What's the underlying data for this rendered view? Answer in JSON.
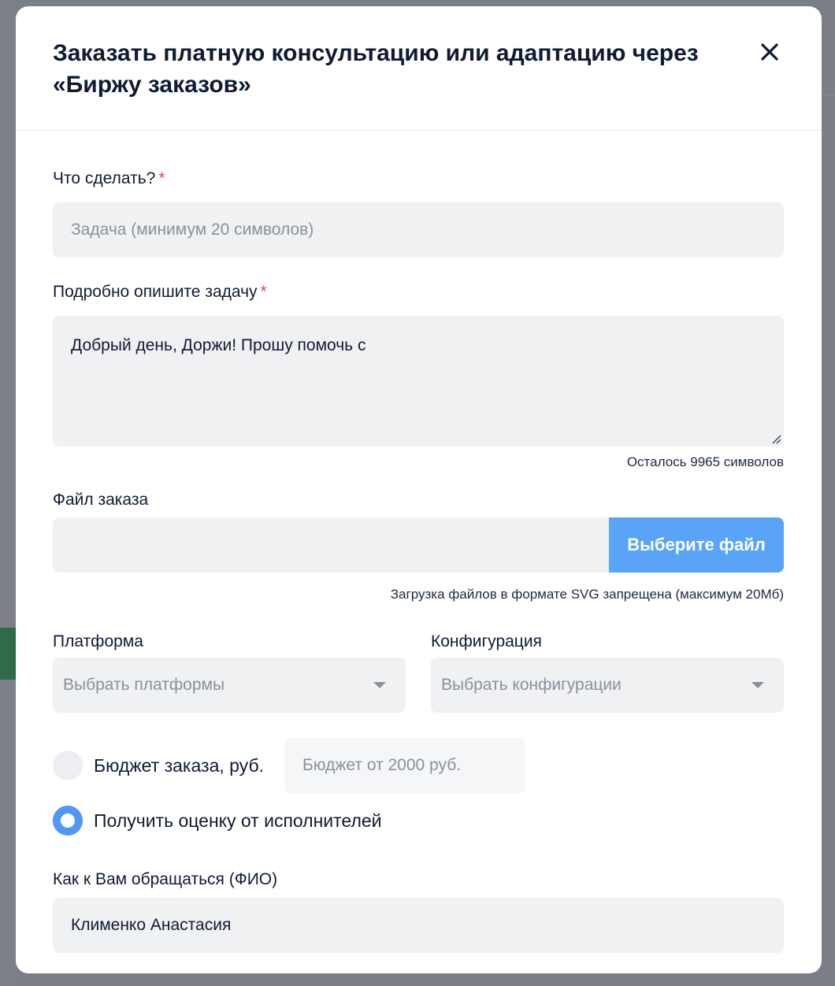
{
  "modal": {
    "title": "Заказать платную консультацию или адаптацию через «Биржу заказов»",
    "close_icon": "close-icon"
  },
  "task": {
    "label": "Что сделать?",
    "required_mark": "*",
    "placeholder": "Задача (минимум 20 символов)"
  },
  "description": {
    "label": "Подробно опишите задачу",
    "required_mark": "*",
    "value": "Добрый день, Доржи! Прошу помочь с",
    "counter": "Осталось 9965 символов"
  },
  "file": {
    "label": "Файл заказа",
    "button": "Выберите файл",
    "hint": "Загрузка файлов в формате SVG запрещена (максимум 20Мб)"
  },
  "platform": {
    "label": "Платформа",
    "placeholder": "Выбрать платформы"
  },
  "configuration": {
    "label": "Конфигурация",
    "placeholder": "Выбрать конфигурации"
  },
  "budget": {
    "option_label": "Бюджет заказа, руб.",
    "input_placeholder": "Бюджет от 2000 руб.",
    "estimate_label": "Получить оценку от исполнителей",
    "selected": "estimate"
  },
  "name": {
    "label": "Как к Вам обращаться (ФИО)",
    "value": "Клименко Анастасия"
  },
  "colors": {
    "accent": "#5aa4f7",
    "required": "#e0445a",
    "field_bg": "#f0f1f3"
  }
}
